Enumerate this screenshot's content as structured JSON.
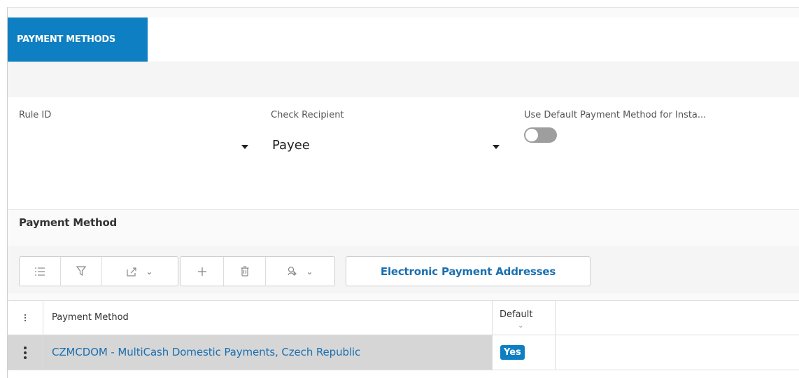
{
  "tab": {
    "label": "PAYMENT METHODS"
  },
  "form": {
    "rule_id": {
      "label": "Rule ID",
      "value": ""
    },
    "check_recipient": {
      "label": "Check Recipient",
      "value": "Payee"
    },
    "use_default": {
      "label": "Use Default Payment Method for Insta...",
      "state": "off"
    }
  },
  "section": {
    "title": "Payment Method"
  },
  "toolbar": {
    "icons": [
      "column-chooser-icon",
      "filter-icon",
      "export-icon",
      "add-icon",
      "delete-icon",
      "actions-icon"
    ],
    "electronic_addresses_label": "Electronic Payment Addresses"
  },
  "grid": {
    "columns": [
      "Payment Method",
      "Default"
    ],
    "rows": [
      {
        "payment_method": "CZMCDOM - MultiCash Domestic Payments, Czech Republic",
        "default": "Yes"
      }
    ]
  },
  "colors": {
    "accent": "#0e7fc2",
    "link": "#1a6fb0",
    "selected_row": "#d6d6d6"
  }
}
